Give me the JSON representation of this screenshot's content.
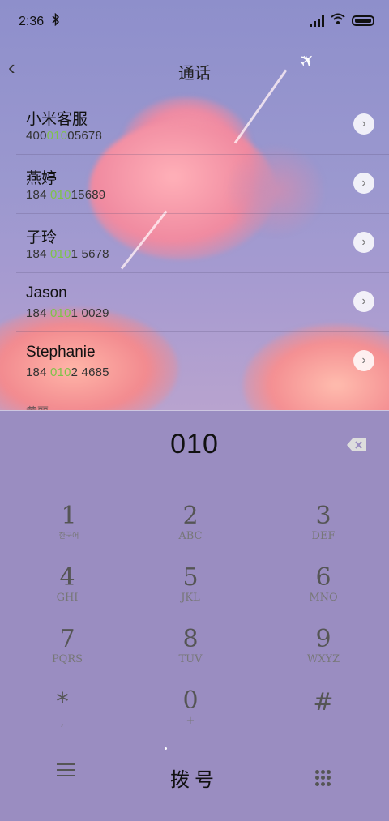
{
  "status": {
    "time": "2:36",
    "icons": [
      "bluetooth-icon",
      "signal-icon",
      "wifi-icon",
      "battery-icon"
    ]
  },
  "header": {
    "title": "通话"
  },
  "contacts": [
    {
      "name": "小米客服",
      "number_pre": "400",
      "number_hl": "010",
      "number_post": "05678"
    },
    {
      "name": "燕婷",
      "number_pre": "184 ",
      "number_hl": "010",
      "number_post": "15689"
    },
    {
      "name": "子玲",
      "number_pre": "184 ",
      "number_hl": "010",
      "number_post": "1 5678"
    },
    {
      "name": "Jason",
      "number_pre": "184 ",
      "number_hl": "010",
      "number_post": "1 0029"
    },
    {
      "name": "Stephanie",
      "number_pre": "184 ",
      "number_hl": "010",
      "number_post": "2 4685"
    }
  ],
  "partial_contact": "黄丽",
  "dialer": {
    "input": "010",
    "keys": [
      {
        "digit": "1",
        "sub": "한국어"
      },
      {
        "digit": "2",
        "sub": "ABC"
      },
      {
        "digit": "3",
        "sub": "DEF"
      },
      {
        "digit": "4",
        "sub": "GHI"
      },
      {
        "digit": "5",
        "sub": "JKL"
      },
      {
        "digit": "6",
        "sub": "MNO"
      },
      {
        "digit": "7",
        "sub": "PQRS"
      },
      {
        "digit": "8",
        "sub": "TUV"
      },
      {
        "digit": "9",
        "sub": "WXYZ"
      },
      {
        "digit": "*",
        "sub": ","
      },
      {
        "digit": "0",
        "sub": "+"
      },
      {
        "digit": "#",
        "sub": ""
      }
    ],
    "dial_label": "拨号"
  },
  "colors": {
    "highlight": "#7fc24a",
    "pad_background": "#9a8dc1"
  }
}
